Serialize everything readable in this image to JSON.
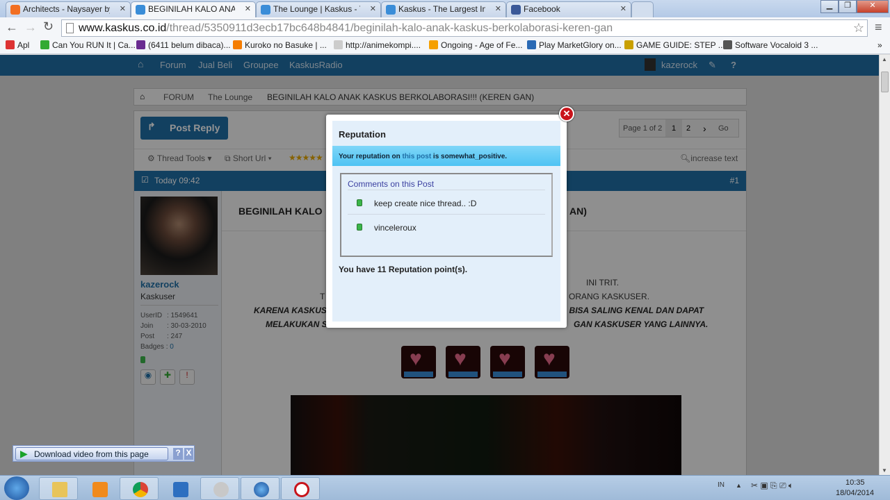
{
  "browser": {
    "tabs": [
      {
        "title": "Architects - Naysayer by E",
        "icon": "soundcloud-icon",
        "color": "#f26f23"
      },
      {
        "title": "BEGINILAH KALO ANAK K",
        "icon": "kaskus-icon",
        "color": "#3a8dd8",
        "active": true
      },
      {
        "title": "The Lounge | Kaskus - The",
        "icon": "kaskus-icon",
        "color": "#3a8dd8"
      },
      {
        "title": "Kaskus - The Largest Indon",
        "icon": "kaskus-icon",
        "color": "#3a8dd8"
      },
      {
        "title": "Facebook",
        "icon": "facebook-icon",
        "color": "#3b5998"
      }
    ],
    "url_domain": "www.kaskus.co.id",
    "url_path": "/thread/5350911d3ecb17bc648b4841/beginilah-kalo-anak-kaskus-berkolaborasi-keren-gan",
    "bookmarks": [
      {
        "label": "Apl",
        "color": "#d33"
      },
      {
        "label": "Can You RUN It | Ca...",
        "color": "#3a3"
      },
      {
        "label": "(6411 belum dibaca)...",
        "color": "#6a2c91"
      },
      {
        "label": "Kuroko no Basuke | ...",
        "color": "#f57d00"
      },
      {
        "label": "http://animekompi....",
        "color": "#ccc"
      },
      {
        "label": "Ongoing - Age of Fe...",
        "color": "#f5a000"
      },
      {
        "label": "Play MarketGlory on...",
        "color": "#2a6ab5"
      },
      {
        "label": "GAME GUIDE: STEP ...",
        "color": "#c9a000"
      },
      {
        "label": "Software Vocaloid 3 ...",
        "color": "#555"
      }
    ],
    "more": "»"
  },
  "nav": {
    "items": [
      "Forum",
      "Jual Beli",
      "Groupee",
      "KaskusRadio"
    ],
    "user": "kazerock"
  },
  "breadcrumb": [
    "FORUM",
    "The Lounge",
    "BEGINILAH KALO ANAK KASKUS BERKOLABORASI!!! (KEREN GAN)"
  ],
  "toolbar": {
    "post_reply": "Post Reply",
    "page_info": "Page 1 of 2",
    "pages": [
      "1",
      "2"
    ],
    "next": "›",
    "go": "Go",
    "thread_tools": "Thread Tools",
    "short_url": "Short Url",
    "increase_text": "increase text"
  },
  "post": {
    "time": "Today 09:42",
    "number": "#1",
    "title_left": "BEGINILAH KALO",
    "title_right": "AN)",
    "user": {
      "name": "kazerock",
      "rank": "Kaskuser",
      "userid_label": "UserID",
      "userid": ": 1549641",
      "join_label": "Join",
      "join": ": 30-03-2010",
      "post_label": "Post",
      "post": ": 247",
      "badges_label": "Badges :",
      "badges": "0"
    },
    "body_lines": [
      {
        "left": "",
        "right": "INI TRIT."
      },
      {
        "left": "T",
        "right": "ORANG KASKUSER."
      },
      {
        "left": "KARENA KASKUS",
        "right": "A BISA SALING KENAL DAN DAPAT"
      },
      {
        "left": "MELAKUKAN S",
        "right": "GAN KASKUSER YANG LAINNYA."
      }
    ]
  },
  "modal": {
    "title": "Reputation",
    "notice_pre": "Your reputation on ",
    "notice_link": "this post",
    "notice_post": " is somewhat_positive.",
    "comments_title": "Comments on this Post",
    "comments": [
      "keep create nice thread.. :D",
      "vinceleroux"
    ],
    "points": "You have 11 Reputation point(s)."
  },
  "download_bar": {
    "label": "Download video from this page",
    "help": "?",
    "close": "X"
  },
  "taskbar": {
    "lang": "IN",
    "time": "10:35",
    "date": "18/04/2014"
  },
  "colors": {
    "kaskus_blue": "#1f6ea6",
    "notice": "#5cc8f5",
    "rep_green": "#3bb54a"
  }
}
